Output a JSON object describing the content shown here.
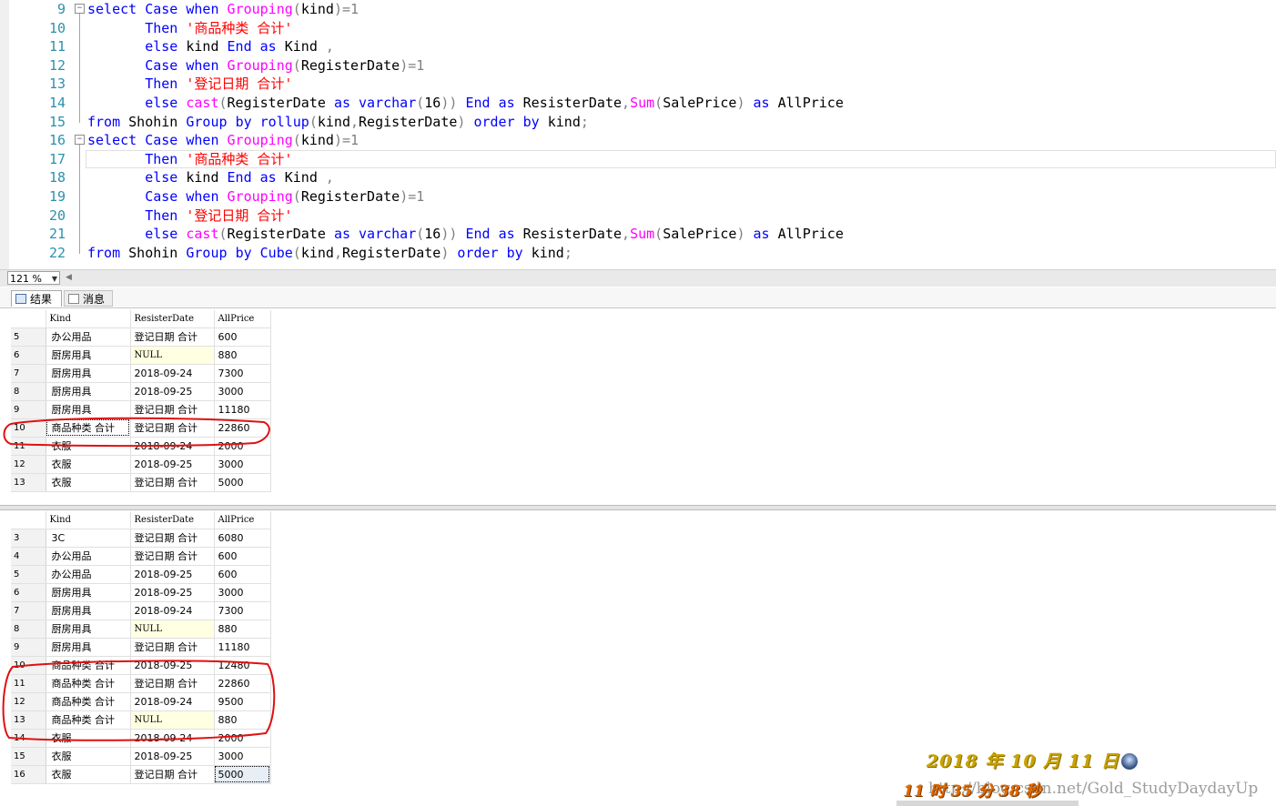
{
  "editor": {
    "lines": [
      {
        "n": "9",
        "fold": "−",
        "tokens": [
          [
            "kw",
            "select "
          ],
          [
            "kw",
            "Case "
          ],
          [
            "kw",
            "when "
          ],
          [
            "fn",
            "Grouping"
          ],
          [
            "gr",
            "("
          ],
          [
            "pl",
            "kind"
          ],
          [
            "gr",
            ")=1"
          ]
        ]
      },
      {
        "n": "10",
        "tokens": [
          [
            "pl",
            "       "
          ],
          [
            "kw",
            "Then "
          ],
          [
            "str",
            "'商品种类 合计'"
          ]
        ]
      },
      {
        "n": "11",
        "tokens": [
          [
            "pl",
            "       "
          ],
          [
            "kw",
            "else "
          ],
          [
            "pl",
            "kind "
          ],
          [
            "kw",
            "End "
          ],
          [
            "kw",
            "as "
          ],
          [
            "pl",
            "Kind "
          ],
          [
            "gr",
            ","
          ]
        ]
      },
      {
        "n": "12",
        "tokens": [
          [
            "pl",
            "       "
          ],
          [
            "kw",
            "Case "
          ],
          [
            "kw",
            "when "
          ],
          [
            "fn",
            "Grouping"
          ],
          [
            "gr",
            "("
          ],
          [
            "pl",
            "RegisterDate"
          ],
          [
            "gr",
            ")=1"
          ]
        ]
      },
      {
        "n": "13",
        "tokens": [
          [
            "pl",
            "       "
          ],
          [
            "kw",
            "Then "
          ],
          [
            "str",
            "'登记日期 合计'"
          ]
        ]
      },
      {
        "n": "14",
        "tokens": [
          [
            "pl",
            "       "
          ],
          [
            "kw",
            "else "
          ],
          [
            "fn",
            "cast"
          ],
          [
            "gr",
            "("
          ],
          [
            "pl",
            "RegisterDate "
          ],
          [
            "kw",
            "as "
          ],
          [
            "kw",
            "varchar"
          ],
          [
            "gr",
            "("
          ],
          [
            "pl",
            "16"
          ],
          [
            "gr",
            "))"
          ],
          [
            "pl",
            " "
          ],
          [
            "kw",
            "End "
          ],
          [
            "kw",
            "as "
          ],
          [
            "pl",
            "ResisterDate"
          ],
          [
            "gr",
            ","
          ],
          [
            "fn",
            "Sum"
          ],
          [
            "gr",
            "("
          ],
          [
            "pl",
            "SalePrice"
          ],
          [
            "gr",
            ")"
          ],
          [
            "pl",
            " "
          ],
          [
            "kw",
            "as "
          ],
          [
            "pl",
            "AllPrice"
          ]
        ]
      },
      {
        "n": "15",
        "tokens": [
          [
            "kw",
            "from "
          ],
          [
            "pl",
            "Shohin "
          ],
          [
            "kw",
            "Group "
          ],
          [
            "kw",
            "by "
          ],
          [
            "kw",
            "rollup"
          ],
          [
            "gr",
            "("
          ],
          [
            "pl",
            "kind"
          ],
          [
            "gr",
            ","
          ],
          [
            "pl",
            "RegisterDate"
          ],
          [
            "gr",
            ")"
          ],
          [
            "pl",
            " "
          ],
          [
            "kw",
            "order "
          ],
          [
            "kw",
            "by "
          ],
          [
            "pl",
            "kind"
          ],
          [
            "gr",
            ";"
          ]
        ]
      },
      {
        "n": "16",
        "fold": "−",
        "tokens": [
          [
            "kw",
            "select "
          ],
          [
            "kw",
            "Case "
          ],
          [
            "kw",
            "when "
          ],
          [
            "fn",
            "Grouping"
          ],
          [
            "gr",
            "("
          ],
          [
            "pl",
            "kind"
          ],
          [
            "gr",
            ")=1"
          ]
        ]
      },
      {
        "n": "17",
        "cur": true,
        "tokens": [
          [
            "pl",
            "       "
          ],
          [
            "kw",
            "Then "
          ],
          [
            "str",
            "'商品种类 合计'"
          ]
        ]
      },
      {
        "n": "18",
        "tokens": [
          [
            "pl",
            "       "
          ],
          [
            "kw",
            "else "
          ],
          [
            "pl",
            "kind "
          ],
          [
            "kw",
            "End "
          ],
          [
            "kw",
            "as "
          ],
          [
            "pl",
            "Kind "
          ],
          [
            "gr",
            ","
          ]
        ]
      },
      {
        "n": "19",
        "tokens": [
          [
            "pl",
            "       "
          ],
          [
            "kw",
            "Case "
          ],
          [
            "kw",
            "when "
          ],
          [
            "fn",
            "Grouping"
          ],
          [
            "gr",
            "("
          ],
          [
            "pl",
            "RegisterDate"
          ],
          [
            "gr",
            ")=1"
          ]
        ]
      },
      {
        "n": "20",
        "tokens": [
          [
            "pl",
            "       "
          ],
          [
            "kw",
            "Then "
          ],
          [
            "str",
            "'登记日期 合计'"
          ]
        ]
      },
      {
        "n": "21",
        "tokens": [
          [
            "pl",
            "       "
          ],
          [
            "kw",
            "else "
          ],
          [
            "fn",
            "cast"
          ],
          [
            "gr",
            "("
          ],
          [
            "pl",
            "RegisterDate "
          ],
          [
            "kw",
            "as "
          ],
          [
            "kw",
            "varchar"
          ],
          [
            "gr",
            "("
          ],
          [
            "pl",
            "16"
          ],
          [
            "gr",
            "))"
          ],
          [
            "pl",
            " "
          ],
          [
            "kw",
            "End "
          ],
          [
            "kw",
            "as "
          ],
          [
            "pl",
            "ResisterDate"
          ],
          [
            "gr",
            ","
          ],
          [
            "fn",
            "Sum"
          ],
          [
            "gr",
            "("
          ],
          [
            "pl",
            "SalePrice"
          ],
          [
            "gr",
            ")"
          ],
          [
            "pl",
            " "
          ],
          [
            "kw",
            "as "
          ],
          [
            "pl",
            "AllPrice"
          ]
        ]
      },
      {
        "n": "22",
        "tokens": [
          [
            "kw",
            "from "
          ],
          [
            "pl",
            "Shohin "
          ],
          [
            "kw",
            "Group "
          ],
          [
            "kw",
            "by "
          ],
          [
            "kw",
            "Cube"
          ],
          [
            "gr",
            "("
          ],
          [
            "pl",
            "kind"
          ],
          [
            "gr",
            ","
          ],
          [
            "pl",
            "RegisterDate"
          ],
          [
            "gr",
            ")"
          ],
          [
            "pl",
            " "
          ],
          [
            "kw",
            "order "
          ],
          [
            "kw",
            "by "
          ],
          [
            "pl",
            "kind"
          ],
          [
            "gr",
            ";"
          ]
        ]
      }
    ],
    "zoom": "121 %"
  },
  "tabs": {
    "results": "结果",
    "messages": "消息"
  },
  "columns": [
    "Kind",
    "ResisterDate",
    "AllPrice"
  ],
  "grid1": [
    {
      "rn": "5",
      "k": "办公用品",
      "d": "登记日期 合计",
      "p": "600"
    },
    {
      "rn": "6",
      "k": "厨房用具",
      "d": "NULL",
      "p": "880",
      "null": true
    },
    {
      "rn": "7",
      "k": "厨房用具",
      "d": "2018-09-24",
      "p": "7300"
    },
    {
      "rn": "8",
      "k": "厨房用具",
      "d": "2018-09-25",
      "p": "3000"
    },
    {
      "rn": "9",
      "k": "厨房用具",
      "d": "登记日期 合计",
      "p": "11180"
    },
    {
      "rn": "10",
      "k": "商品种类 合计",
      "d": "登记日期 合计",
      "p": "22860",
      "sel": true
    },
    {
      "rn": "11",
      "k": "衣服",
      "d": "2018-09-24",
      "p": "2000"
    },
    {
      "rn": "12",
      "k": "衣服",
      "d": "2018-09-25",
      "p": "3000"
    },
    {
      "rn": "13",
      "k": "衣服",
      "d": "登记日期 合计",
      "p": "5000"
    }
  ],
  "grid2": [
    {
      "rn": "3",
      "k": "3C",
      "d": "登记日期 合计",
      "p": "6080"
    },
    {
      "rn": "4",
      "k": "办公用品",
      "d": "登记日期 合计",
      "p": "600"
    },
    {
      "rn": "5",
      "k": "办公用品",
      "d": "2018-09-25",
      "p": "600"
    },
    {
      "rn": "6",
      "k": "厨房用具",
      "d": "2018-09-25",
      "p": "3000"
    },
    {
      "rn": "7",
      "k": "厨房用具",
      "d": "2018-09-24",
      "p": "7300"
    },
    {
      "rn": "8",
      "k": "厨房用具",
      "d": "NULL",
      "p": "880",
      "null": true
    },
    {
      "rn": "9",
      "k": "厨房用具",
      "d": "登记日期 合计",
      "p": "11180"
    },
    {
      "rn": "10",
      "k": "商品种类 合计",
      "d": "2018-09-25",
      "p": "12480"
    },
    {
      "rn": "11",
      "k": "商品种类 合计",
      "d": "登记日期 合计",
      "p": "22860"
    },
    {
      "rn": "12",
      "k": "商品种类 合计",
      "d": "2018-09-24",
      "p": "9500"
    },
    {
      "rn": "13",
      "k": "商品种类 合计",
      "d": "NULL",
      "p": "880",
      "null": true
    },
    {
      "rn": "14",
      "k": "衣服",
      "d": "2018-09-24",
      "p": "2000"
    },
    {
      "rn": "15",
      "k": "衣服",
      "d": "2018-09-25",
      "p": "3000"
    },
    {
      "rn": "16",
      "k": "衣服",
      "d": "登记日期 合计",
      "p": "5000",
      "lastsel": true
    }
  ],
  "watermark": {
    "date": "2018 年 10 月 11 日",
    "time": "11 时 35 分 38 秒",
    "url": "http://blog.csdn.net/Gold_StudyDaydayUp"
  },
  "colors": {
    "keyword": "#0000ff",
    "function": "#ff00ff",
    "string": "#ff0000",
    "operator": "#808080",
    "line_number": "#2b91af",
    "null_cell": "#ffffe1",
    "annotation": "#e01010"
  }
}
